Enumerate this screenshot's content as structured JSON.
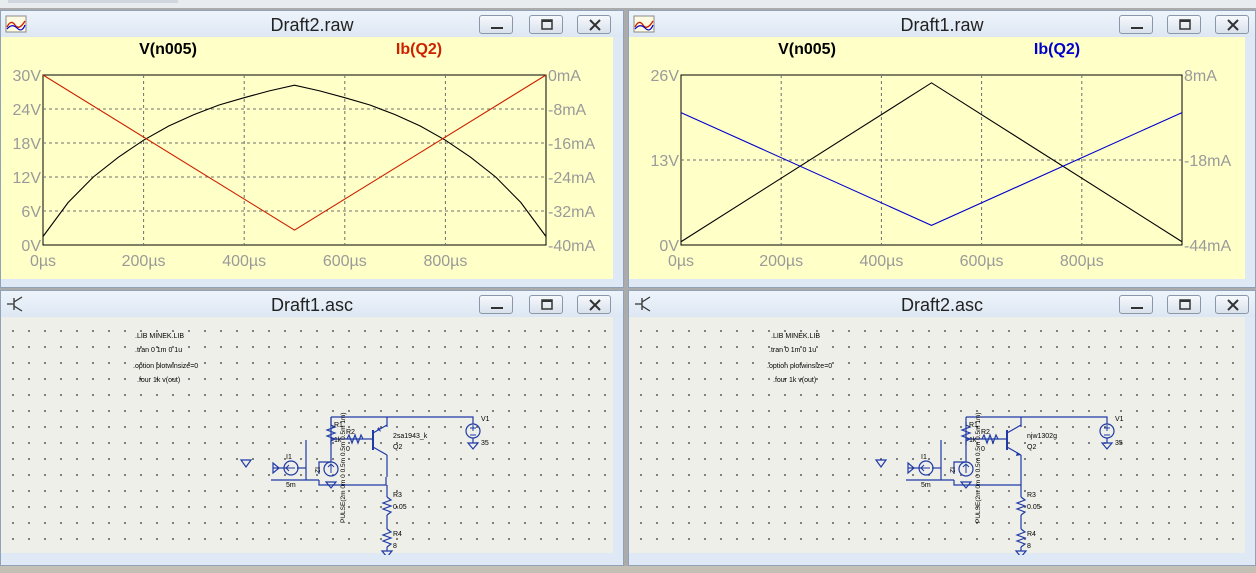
{
  "colors": {
    "trace_black": "#000000",
    "trace_red": "#cc2200",
    "trace_blue": "#0000cc",
    "plot_bg": "#ffffc8",
    "grid": "#6f6f6f",
    "tick_text": "#9a9a9a"
  },
  "icons": {
    "waveform": "waveform-icon",
    "schematic": "schematic-icon",
    "minimize": "minimize-icon",
    "maximize": "maximize-icon",
    "close": "close-icon"
  },
  "windows": {
    "draft2_raw": {
      "title": "Draft2.raw",
      "trace_left": "V(n005)",
      "trace_right": "Ib(Q2)",
      "chart_data": {
        "type": "line",
        "x_ticks": [
          "0µs",
          "200µs",
          "400µs",
          "600µs",
          "800µs"
        ],
        "y_left_ticks": [
          "30V",
          "24V",
          "18V",
          "12V",
          "6V",
          "0V"
        ],
        "y_right_ticks": [
          "0mA",
          "-8mA",
          "-16mA",
          "-24mA",
          "-32mA",
          "-40mA"
        ],
        "xlim": [
          0,
          1000
        ],
        "ylim_left": [
          0,
          30
        ],
        "ylim_right": [
          -40,
          0
        ],
        "grid": true,
        "series": [
          {
            "name": "V(n005)",
            "axis": "left",
            "color": "#000000",
            "x": [
              0,
              50,
              100,
              150,
              200,
              250,
              300,
              350,
              400,
              450,
              500,
              550,
              600,
              650,
              700,
              750,
              800,
              850,
              900,
              950,
              1000
            ],
            "values": [
              1.5,
              7.5,
              12,
              15.5,
              18.5,
              21,
              23,
              24.7,
              26,
              27.2,
              28.2,
              27.2,
              26,
              24.7,
              23,
              21,
              18.5,
              15.5,
              12,
              7.5,
              1.5
            ]
          },
          {
            "name": "Ib(Q2)",
            "axis": "right",
            "color": "#cc2200",
            "x": [
              0,
              500,
              1000
            ],
            "values": [
              0,
              -36.5,
              0
            ]
          }
        ]
      }
    },
    "draft1_raw": {
      "title": "Draft1.raw",
      "trace_left": "V(n005)",
      "trace_right": "Ib(Q2)",
      "chart_data": {
        "type": "line",
        "x_ticks": [
          "0µs",
          "200µs",
          "400µs",
          "600µs",
          "800µs"
        ],
        "y_left_ticks": [
          "26V",
          "13V",
          "0V"
        ],
        "y_right_ticks": [
          "8mA",
          "-18mA",
          "-44mA"
        ],
        "xlim": [
          0,
          1000
        ],
        "ylim_left": [
          0,
          26
        ],
        "ylim_right": [
          -44,
          8
        ],
        "grid": true,
        "series": [
          {
            "name": "V(n005)",
            "axis": "left",
            "color": "#000000",
            "x": [
              0,
              500,
              1000
            ],
            "values": [
              0.5,
              24.8,
              0.5
            ]
          },
          {
            "name": "Ib(Q2)",
            "axis": "right",
            "color": "#0000cc",
            "x": [
              0,
              500,
              1000
            ],
            "values": [
              -3.5,
              -38,
              -3.5
            ]
          }
        ]
      }
    },
    "draft1_asc": {
      "title": "Draft1.asc",
      "directives": [
        ".LIB MINEK.LIB",
        ".tran 0 1m 0 1u",
        ".option plotwinsize=0",
        ".four 1k v(out)"
      ],
      "labels": {
        "i1": "I1",
        "i1_val": "5m",
        "r1": "R1",
        "r1_val": "1k",
        "r2": "R2",
        "r2_val": "0",
        "i2": "I2",
        "pulse": "PULSE(2m 0m 0 0.5m 0.5m 0.5m 1m)",
        "q_model": "2sa1943_k",
        "q_name": "Q2",
        "r3": "R3",
        "r3_val": "0.05",
        "r4": "R4",
        "r4_val": "8",
        "v1": "V1",
        "v1_val": "35"
      }
    },
    "draft2_asc": {
      "title": "Draft2.asc",
      "directives": [
        ".LIB MINEK.LIB",
        ".tran 0 1m 0 1u",
        ".option plotwinsize=0",
        ".four 1k v(out)"
      ],
      "labels": {
        "i1": "I1",
        "i1_val": "5m",
        "r1": "R1",
        "r1_val": "1k",
        "r2": "R2",
        "r2_val": "0",
        "i2": "I2",
        "pulse": "PULSE(2m 0m 0 0.5m 0.5m 0.5m 1m)",
        "q_model": "njw1302g",
        "q_name": "Q2",
        "r3": "R3",
        "r3_val": "0.05",
        "r4": "R4",
        "r4_val": "8",
        "v1": "V1",
        "v1_val": "35"
      }
    }
  }
}
